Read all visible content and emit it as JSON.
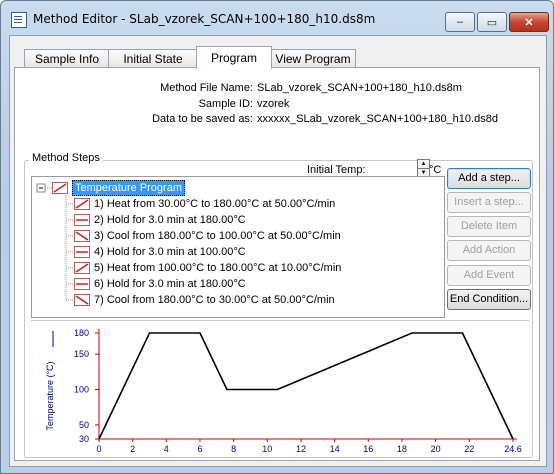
{
  "window": {
    "title": "Method Editor - SLab_vzorek_SCAN+100+180_h10.ds8m",
    "minimize_glyph": "‒",
    "maximize_glyph": "▭",
    "close_glyph": "✕"
  },
  "tabs": [
    {
      "label": "Sample Info"
    },
    {
      "label": "Initial State"
    },
    {
      "label": "Program",
      "active": true
    },
    {
      "label": "View Program"
    }
  ],
  "info": {
    "method_file_label": "Method File Name:",
    "method_file_value": "SLab_vzorek_SCAN+100+180_h10.ds8m",
    "sample_id_label": "Sample ID:",
    "sample_id_value": "vzorek",
    "data_saved_label": "Data to be saved as:",
    "data_saved_value": "xxxxxx_SLab_vzorek_SCAN+100+180_h10.ds8d"
  },
  "method_steps": {
    "group_title": "Method Steps",
    "initial_temp_label": "Initial Temp:",
    "initial_temp_unit": "°C",
    "root_label": "Temperature Program",
    "steps": [
      {
        "label": "1) Heat from 30.00°C to 180.00°C at 50.00°C/min",
        "icon": "heat-ramp-icon"
      },
      {
        "label": "2) Hold for 3.0 min at 180.00°C",
        "icon": "hold-icon"
      },
      {
        "label": "3) Cool from 180.00°C to 100.00°C at 50.00°C/min",
        "icon": "cool-ramp-icon"
      },
      {
        "label": "4) Hold for 3.0 min at 100.00°C",
        "icon": "hold-icon"
      },
      {
        "label": "5) Heat from 100.00°C to 180.00°C at 10.00°C/min",
        "icon": "heat-ramp-icon"
      },
      {
        "label": "6) Hold for 3.0 min at 180.00°C",
        "icon": "hold-icon"
      },
      {
        "label": "7) Cool from 180.00°C to 30.00°C at 50.00°C/min",
        "icon": "cool-ramp-icon"
      }
    ]
  },
  "buttons": {
    "add_step": "Add a step...",
    "insert_step": "Insert a step...",
    "delete_item": "Delete Item",
    "add_action": "Add Action",
    "add_event": "Add Event",
    "end_condition": "End Condition..."
  },
  "chart_data": {
    "type": "line",
    "xlabel": "Time (min)",
    "ylabel": "Temperature (°C)",
    "x_ticks": [
      "0",
      "2",
      "4",
      "6",
      "8",
      "10",
      "12",
      "14",
      "16",
      "18",
      "20",
      "22",
      "24.6"
    ],
    "y_ticks": [
      "30",
      "50",
      "100",
      "150",
      "180"
    ],
    "xlim": [
      0,
      24.6
    ],
    "ylim": [
      30,
      180
    ],
    "series": [
      {
        "x": [
          0,
          3.0,
          6.0,
          7.6,
          10.6,
          18.6,
          21.6,
          24.6
        ],
        "y": [
          30,
          180,
          180,
          100,
          100,
          180,
          180,
          30
        ]
      }
    ],
    "line_color": "#000000",
    "axis_color": "#cc0000",
    "label_color": "#00008b"
  }
}
